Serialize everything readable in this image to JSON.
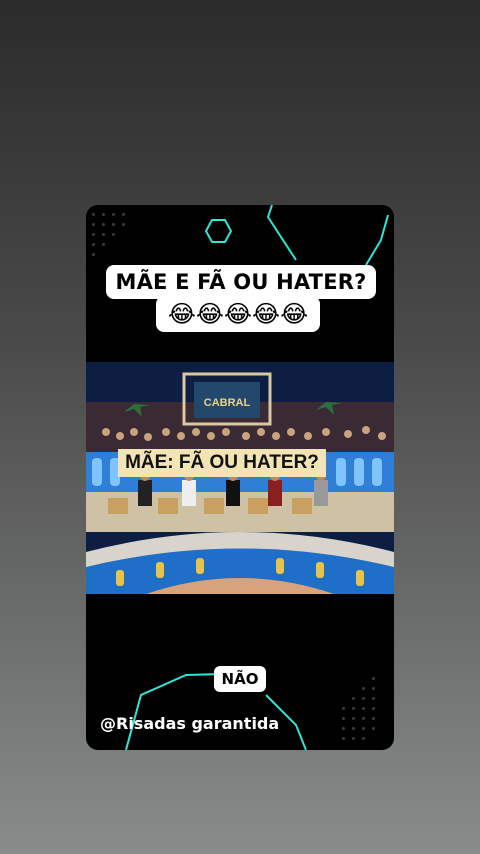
{
  "caption": {
    "line1": "MÃE E FÃ  OU HATER?",
    "emoji": "😂😂😂😂😂"
  },
  "video": {
    "show_logo": "CABRAL",
    "banner": "MÃE: FÃ OU HATER?"
  },
  "answer_label": "NÃO",
  "watermark": "@Risadas garantida",
  "colors": {
    "neon": "#2ee6d6",
    "card": "#000000"
  }
}
